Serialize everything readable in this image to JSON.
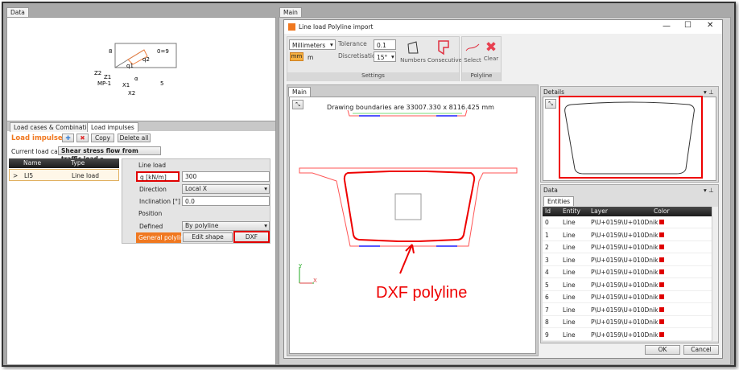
{
  "left": {
    "tab": "Data",
    "diagram": {
      "labels": [
        "8",
        "0=9",
        "q1",
        "q2",
        "Z2",
        "Z1",
        "MP-1",
        "X1",
        "X2",
        "5",
        "α"
      ]
    },
    "subtabs": [
      "Load cases & Combinations",
      "Load impulses"
    ],
    "toolbar": {
      "title": "Load impulses",
      "add_icon": "plus-icon",
      "delete_icon": "x-icon",
      "copy": "Copy",
      "delete_all": "Delete all"
    },
    "load_case": {
      "label": "Current load case",
      "value": "Shear stress flow from traffic load"
    },
    "table": {
      "headers": [
        "Name",
        "Type"
      ],
      "rows": [
        {
          "marker": ">",
          "name": "LI5",
          "type": "Line load"
        }
      ]
    },
    "props": {
      "section1": "Line load",
      "q_label": "q [kN/m]",
      "q_value": "300",
      "direction_label": "Direction",
      "direction_value": "Local X",
      "inclination_label": "Inclination [°]",
      "inclination_value": "0.0",
      "section2": "Position",
      "defined_label": "Defined",
      "defined_value": "By polyline",
      "polyline_label": "General polyline",
      "edit_shape": "Edit shape",
      "dxf": "DXF"
    }
  },
  "right": {
    "tab": "Main",
    "dialog": {
      "title": "Line load Polyline import",
      "units": "Millimeters",
      "unit_mm": "mm",
      "unit_m": "m",
      "tolerance_label": "Tolerance",
      "tolerance_value": "0.1",
      "discretisation_label": "Discretisation",
      "discretisation_value": "15°",
      "numbers": "Numbers",
      "consecutive": "Consecutive",
      "settings_group": "Settings",
      "select": "Select",
      "clear": "Clear",
      "polyline_group": "Polyline",
      "main_tab": "Main",
      "boundaries": "Drawing boundaries are 33007.330 x 8116.425 mm",
      "axis_y": "Y",
      "axis_x": "X",
      "annotation": "DXF polyline",
      "details_title": "Details",
      "data_title": "Data",
      "entities_tab": "Entities",
      "entity_headers": [
        "Id",
        "Entity",
        "Layer",
        "Color"
      ],
      "entities": [
        {
          "id": "0",
          "entity": "Line",
          "layer": "P\\U+0159\\U+010Dnik"
        },
        {
          "id": "1",
          "entity": "Line",
          "layer": "P\\U+0159\\U+010Dnik"
        },
        {
          "id": "2",
          "entity": "Line",
          "layer": "P\\U+0159\\U+010Dnik"
        },
        {
          "id": "3",
          "entity": "Line",
          "layer": "P\\U+0159\\U+010Dnik"
        },
        {
          "id": "4",
          "entity": "Line",
          "layer": "P\\U+0159\\U+010Dnik"
        },
        {
          "id": "5",
          "entity": "Line",
          "layer": "P\\U+0159\\U+010Dnik"
        },
        {
          "id": "6",
          "entity": "Line",
          "layer": "P\\U+0159\\U+010Dnik"
        },
        {
          "id": "7",
          "entity": "Line",
          "layer": "P\\U+0159\\U+010Dnik"
        },
        {
          "id": "8",
          "entity": "Line",
          "layer": "P\\U+0159\\U+010Dnik"
        },
        {
          "id": "9",
          "entity": "Line",
          "layer": "P\\U+0159\\U+010Dnik"
        }
      ],
      "entity_color": "#e00000",
      "ok": "OK",
      "cancel": "Cancel"
    }
  },
  "colors": {
    "accent": "#f07820",
    "highlight": "#e00000"
  }
}
